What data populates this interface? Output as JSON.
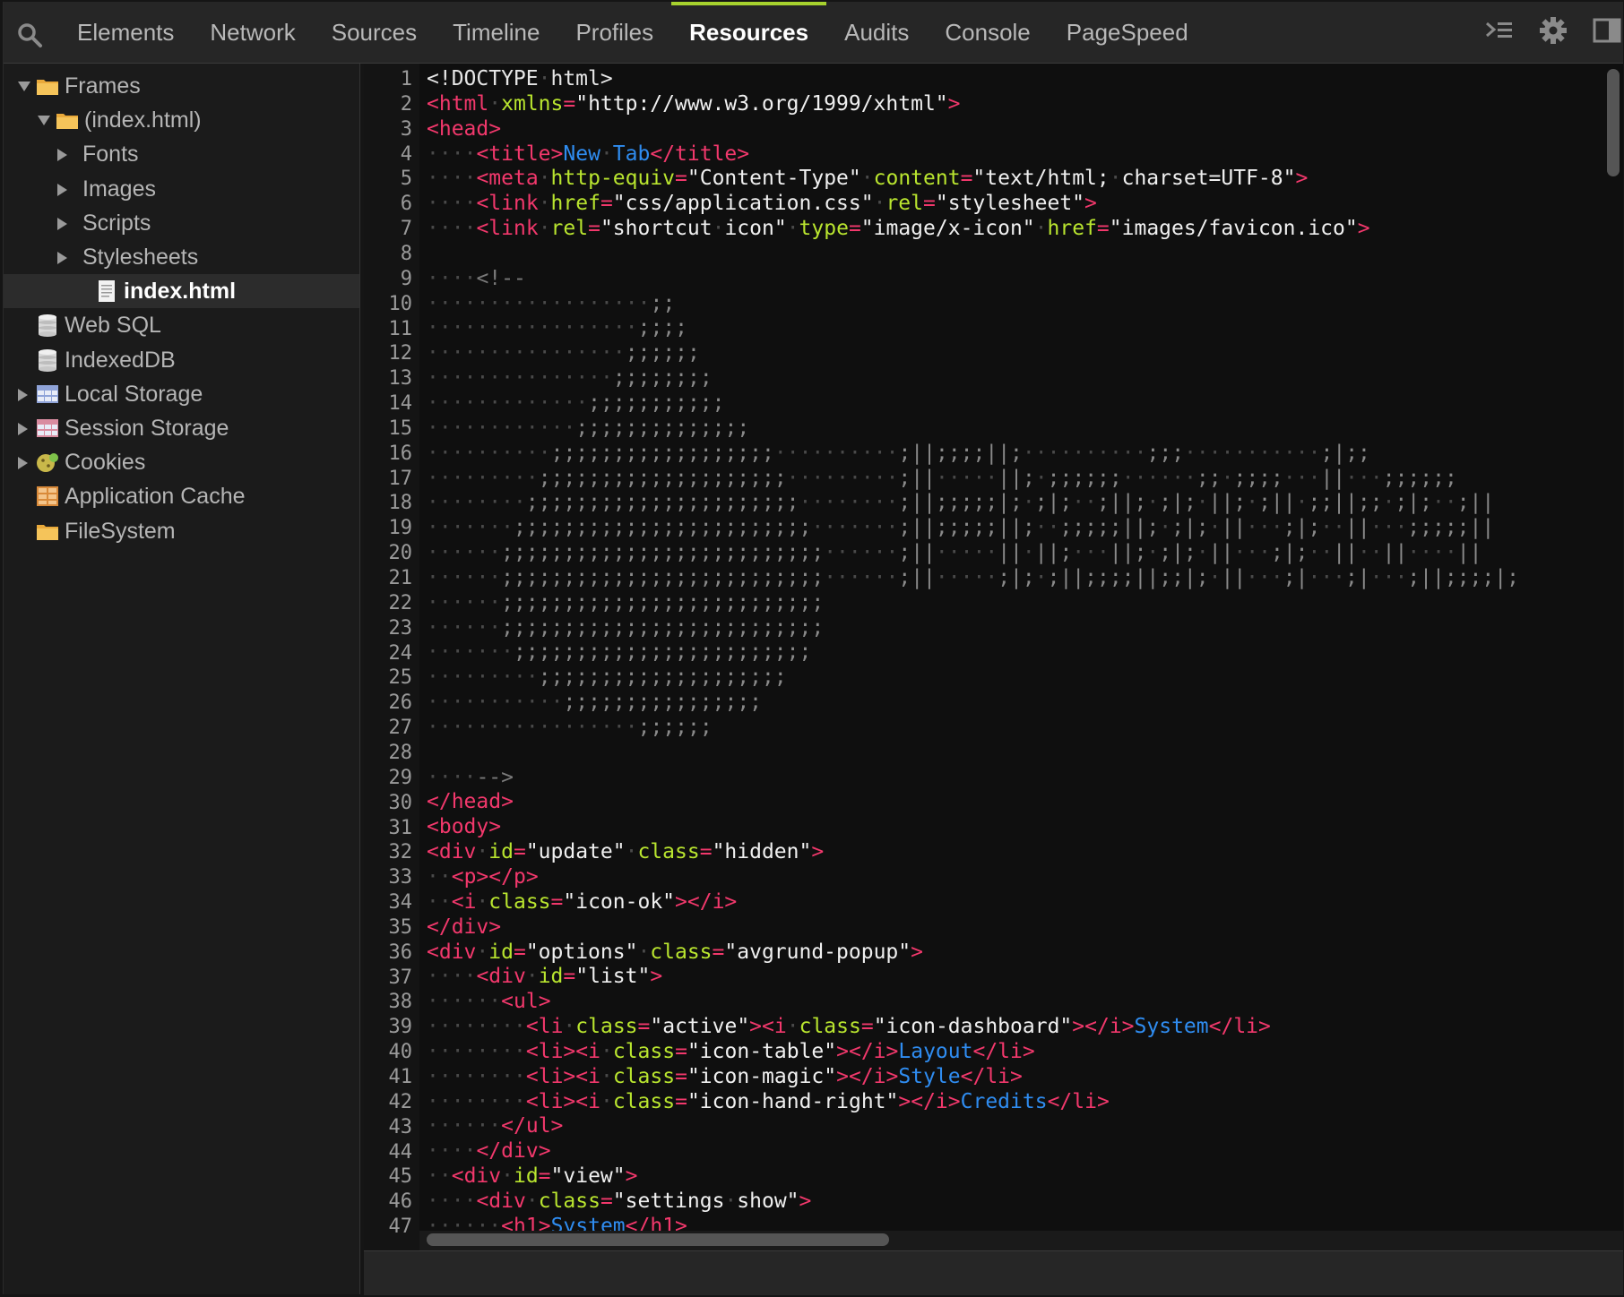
{
  "toolbar": {
    "tabs": [
      {
        "label": "Elements"
      },
      {
        "label": "Network"
      },
      {
        "label": "Sources"
      },
      {
        "label": "Timeline"
      },
      {
        "label": "Profiles"
      },
      {
        "label": "Resources",
        "active": true
      },
      {
        "label": "Audits"
      },
      {
        "label": "Console"
      },
      {
        "label": "PageSpeed"
      }
    ],
    "accent_color": "#a7d22e"
  },
  "sidebar": {
    "items": [
      {
        "label": "Frames",
        "indent": 0,
        "expander": "down",
        "icon": "folder-icon"
      },
      {
        "label": "(index.html)",
        "indent": 1,
        "expander": "down",
        "icon": "folder-icon"
      },
      {
        "label": "Fonts",
        "indent": 2,
        "expander": "right",
        "icon": ""
      },
      {
        "label": "Images",
        "indent": 2,
        "expander": "right",
        "icon": ""
      },
      {
        "label": "Scripts",
        "indent": 2,
        "expander": "right",
        "icon": ""
      },
      {
        "label": "Stylesheets",
        "indent": 2,
        "expander": "right",
        "icon": ""
      },
      {
        "label": "index.html",
        "indent": 3,
        "expander": "",
        "icon": "document-icon",
        "selected": true
      },
      {
        "label": "Web SQL",
        "indent": 0,
        "expander": "",
        "icon": "database-icon"
      },
      {
        "label": "IndexedDB",
        "indent": 0,
        "expander": "",
        "icon": "database-icon"
      },
      {
        "label": "Local Storage",
        "indent": 0,
        "expander": "right",
        "icon": "table-icon"
      },
      {
        "label": "Session Storage",
        "indent": 0,
        "expander": "right",
        "icon": "table-icon"
      },
      {
        "label": "Cookies",
        "indent": 0,
        "expander": "right",
        "icon": "cookie-icon"
      },
      {
        "label": "Application Cache",
        "indent": 0,
        "expander": "",
        "icon": "grid-icon"
      },
      {
        "label": "FileSystem",
        "indent": 0,
        "expander": "",
        "icon": "folder-icon"
      }
    ]
  },
  "editor": {
    "lines": [
      "<!DOCTYPE html>",
      "<html xmlns=\"http://www.w3.org/1999/xhtml\">",
      "<head>",
      "    <title>New Tab</title>",
      "    <meta http-equiv=\"Content-Type\" content=\"text/html; charset=UTF-8\">",
      "    <link href=\"css/application.css\" rel=\"stylesheet\">",
      "    <link rel=\"shortcut icon\" type=\"image/x-icon\" href=\"images/favicon.ico\">",
      "",
      "    <!--",
      "                  ;;",
      "                 ;;;;",
      "                ;;;;;;",
      "               ;;;;;;;;",
      "             ;;;;;;;;;;;",
      "            ;;;;;;;;;;;;;;",
      "          ;;;;;;;;;;;;;;;;;;          ;||;;;;||;          ;;;           ;|;;",
      "         ;;;;;;;;;;;;;;;;;;;;         ;||     ||; ;;;;;;      ;; ;;;;   ||   ;;;;;;",
      "        ;;;;;;;;;;;;;;;;;;;;;;        ;||;;;;;|; ;|;  ;||; ;|; ||; ;|| ;;||;; ;|;  ;||",
      "       ;;;;;;;;;;;;;;;;;;;;;;;;       ;||;;;;;||;  ;;;;;||; ;|; ||   ;|;  ||   ;;;;;||",
      "      ;;;;;;;;;;;;;;;;;;;;;;;;;;      ;||     || ||;   ||; ;|; ||   ;|;  ||  ||    ||",
      "      ;;;;;;;;;;;;;;;;;;;;;;;;;;      ;||     ;|; ;||;;;;||;;|; ||   ;|   ;|   ;||;;;;|;",
      "      ;;;;;;;;;;;;;;;;;;;;;;;;;;",
      "      ;;;;;;;;;;;;;;;;;;;;;;;;;;",
      "       ;;;;;;;;;;;;;;;;;;;;;;;;",
      "         ;;;;;;;;;;;;;;;;;;;;",
      "           ;;;;;;;;;;;;;;;;",
      "                 ;;;;;;",
      "",
      "    -->",
      "</head>",
      "<body>",
      "<div id=\"update\" class=\"hidden\">",
      "  <p></p>",
      "  <i class=\"icon-ok\"></i>",
      "</div>",
      "<div id=\"options\" class=\"avgrund-popup\">",
      "    <div id=\"list\">",
      "      <ul>",
      "        <li class=\"active\"><i class=\"icon-dashboard\"></i>System</li>",
      "        <li><i class=\"icon-table\"></i>Layout</li>",
      "        <li><i class=\"icon-magic\"></i>Style</li>",
      "        <li><i class=\"icon-hand-right\"></i>Credits</li>",
      "      </ul>",
      "    </div>",
      "  <div id=\"view\">",
      "    <div class=\"settings show\">",
      "      <h1>System</h1>"
    ],
    "colors": {
      "tag": "#f2386c",
      "attribute": "#b9e52f",
      "string": "#f0f0f0",
      "text": "#2f8cf0",
      "comment": "#7a7a7a"
    }
  }
}
